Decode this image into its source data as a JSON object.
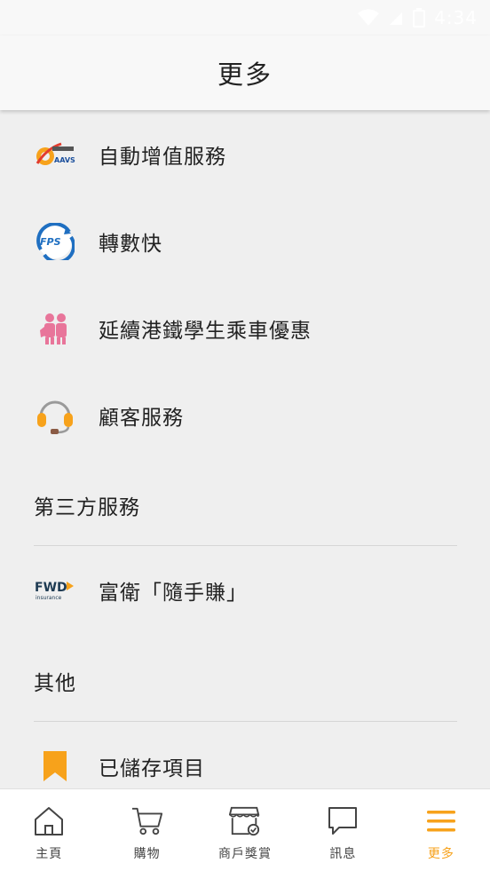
{
  "status_bar": {
    "time": "4:34"
  },
  "header": {
    "title": "更多"
  },
  "menu": {
    "items": [
      {
        "label": "自動增值服務",
        "icon": "aavs-logo-icon"
      },
      {
        "label": "轉數快",
        "icon": "fps-logo-icon"
      },
      {
        "label": "延續港鐵學生乘車優惠",
        "icon": "students-icon"
      },
      {
        "label": "顧客服務",
        "icon": "headset-icon"
      }
    ],
    "third_party": {
      "title": "第三方服務",
      "items": [
        {
          "label": "富衛「隨手賺」",
          "icon": "fwd-logo-icon"
        }
      ]
    },
    "others": {
      "title": "其他",
      "items": [
        {
          "label": "已儲存項目",
          "icon": "bookmark-icon"
        }
      ]
    }
  },
  "logos": {
    "aavs_text": "AAVS",
    "fps_text": "FPS",
    "fwd_text": "FWD",
    "fwd_subtext": "insurance"
  },
  "bottom_nav": {
    "items": [
      {
        "label": "主頁",
        "icon": "home-icon",
        "active": false
      },
      {
        "label": "購物",
        "icon": "cart-icon",
        "active": false
      },
      {
        "label": "商戶獎賞",
        "icon": "store-icon",
        "active": false
      },
      {
        "label": "訊息",
        "icon": "chat-icon",
        "active": false
      },
      {
        "label": "更多",
        "icon": "menu-icon",
        "active": true
      }
    ]
  },
  "colors": {
    "accent": "#f7a21b",
    "background": "#efefef",
    "header": "#f8f8f8",
    "pink": "#e8759a",
    "fps_blue": "#1f6fc1"
  }
}
